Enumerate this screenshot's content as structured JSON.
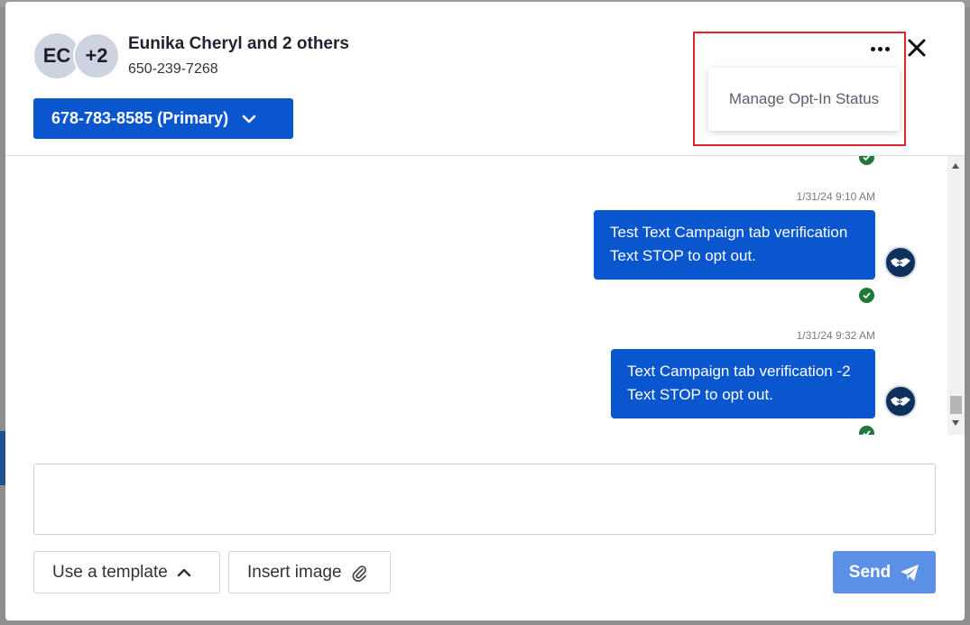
{
  "header": {
    "avatar_initials": "EC",
    "avatar_extra": "+2",
    "contact_name": "Eunika Cheryl and 2 others",
    "contact_phone": "650-239-7268",
    "from_number": "678-783-8585 (Primary)"
  },
  "menu": {
    "items": [
      {
        "label": "Manage Opt-In Status"
      }
    ]
  },
  "messages": [
    {
      "timestamp": "1/31/24 9:10 AM",
      "lines": [
        "Test Text Campaign tab verification",
        "Text STOP to opt out."
      ],
      "status": "delivered"
    },
    {
      "timestamp": "1/31/24 9:32 AM",
      "lines": [
        "Text Campaign tab verification -2",
        "Text STOP to opt out."
      ],
      "status": "delivered"
    }
  ],
  "composer": {
    "value": "",
    "template_label": "Use a template",
    "insert_image_label": "Insert image",
    "send_label": "Send"
  },
  "icons": {
    "more": "more-horizontal-icon",
    "close": "close-icon",
    "chevron": "chevron-down-icon",
    "check": "check-circle-icon",
    "sender": "handshake-icon",
    "attach": "paperclip-icon",
    "send": "paper-plane-icon"
  },
  "colors": {
    "primary": "#0a56cf",
    "send_disabled": "#5b90e6",
    "delivered": "#1f7a3a",
    "highlight": "#e0262c"
  }
}
